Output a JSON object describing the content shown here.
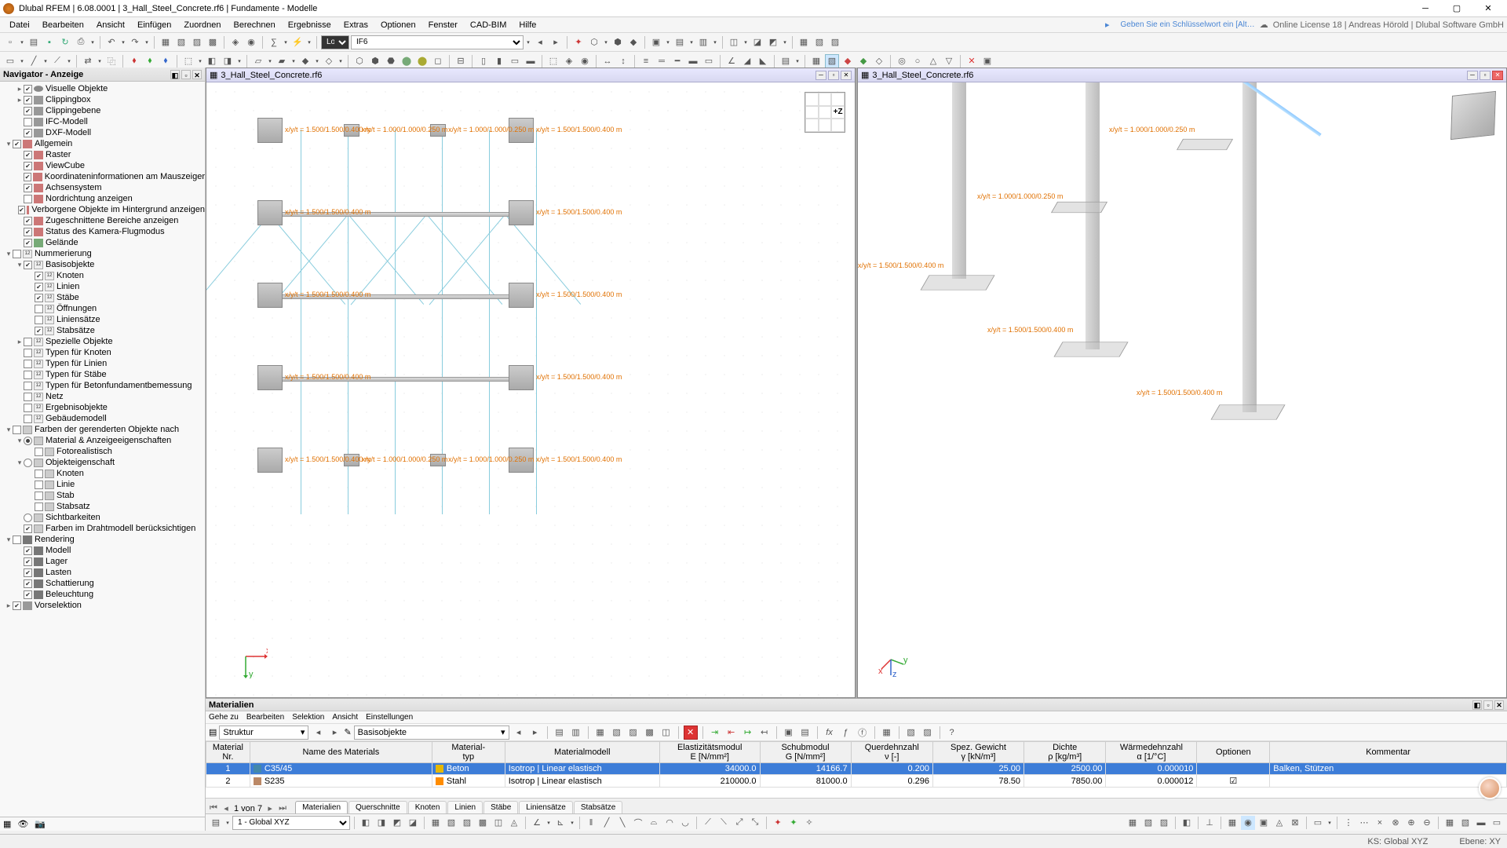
{
  "app": {
    "title": "Dlubal RFEM | 6.08.0001 | 3_Hall_Steel_Concrete.rf6 | Fundamente - Modelle"
  },
  "header": {
    "hint": "Geben Sie ein Schlüsselwort ein [Alt…",
    "license": "Online License 18 | Andreas Hörold | Dlubal Software GmbH"
  },
  "menu": {
    "items": [
      "Datei",
      "Bearbeiten",
      "Ansicht",
      "Einfügen",
      "Zuordnen",
      "Berechnen",
      "Ergebnisse",
      "Extras",
      "Optionen",
      "Fenster",
      "CAD-BIM",
      "Hilfe"
    ]
  },
  "tb1_combo_lol": "LoI",
  "tb1_combo_if": "IF6",
  "navigator": {
    "title": "Navigator - Anzeige",
    "footer_cam_icon": "📷",
    "tree": [
      {
        "d": 1,
        "tw": "▸",
        "cb": true,
        "icon": "ic-eye",
        "label": "Visuelle Objekte"
      },
      {
        "d": 1,
        "tw": "▸",
        "cb": true,
        "icon": "ic-cube",
        "label": "Clippingbox"
      },
      {
        "d": 1,
        "tw": "",
        "cb": true,
        "icon": "ic-cube",
        "label": "Clippingebene"
      },
      {
        "d": 1,
        "tw": "",
        "cb": false,
        "icon": "ic-cube",
        "label": "IFC-Modell"
      },
      {
        "d": 1,
        "tw": "",
        "cb": true,
        "icon": "ic-cube",
        "label": "DXF-Modell"
      },
      {
        "d": 0,
        "tw": "▾",
        "cb": true,
        "icon": "ic-layer",
        "label": "Allgemein"
      },
      {
        "d": 1,
        "tw": "",
        "cb": true,
        "icon": "ic-layer",
        "label": "Raster"
      },
      {
        "d": 1,
        "tw": "",
        "cb": true,
        "icon": "ic-layer",
        "label": "ViewCube"
      },
      {
        "d": 1,
        "tw": "",
        "cb": true,
        "icon": "ic-layer",
        "label": "Koordinateninformationen am Mauszeiger"
      },
      {
        "d": 1,
        "tw": "",
        "cb": true,
        "icon": "ic-layer",
        "label": "Achsensystem"
      },
      {
        "d": 1,
        "tw": "",
        "cb": false,
        "icon": "ic-layer",
        "label": "Nordrichtung anzeigen"
      },
      {
        "d": 1,
        "tw": "",
        "cb": true,
        "icon": "ic-layer",
        "label": "Verborgene Objekte im Hintergrund anzeigen"
      },
      {
        "d": 1,
        "tw": "",
        "cb": true,
        "icon": "ic-layer",
        "label": "Zugeschnittene Bereiche anzeigen"
      },
      {
        "d": 1,
        "tw": "",
        "cb": true,
        "icon": "ic-layer",
        "label": "Status des Kamera-Flugmodus"
      },
      {
        "d": 1,
        "tw": "",
        "cb": true,
        "icon": "ic-layer2",
        "label": "Gelände"
      },
      {
        "d": 0,
        "tw": "▾",
        "cb": false,
        "icon": "ic-num",
        "label": "Nummerierung"
      },
      {
        "d": 1,
        "tw": "▾",
        "cb": true,
        "icon": "ic-num",
        "label": "Basisobjekte"
      },
      {
        "d": 2,
        "tw": "",
        "cb": true,
        "icon": "ic-num",
        "label": "Knoten"
      },
      {
        "d": 2,
        "tw": "",
        "cb": true,
        "icon": "ic-num",
        "label": "Linien"
      },
      {
        "d": 2,
        "tw": "",
        "cb": true,
        "icon": "ic-num",
        "label": "Stäbe"
      },
      {
        "d": 2,
        "tw": "",
        "cb": false,
        "icon": "ic-num",
        "label": "Öffnungen"
      },
      {
        "d": 2,
        "tw": "",
        "cb": false,
        "icon": "ic-num",
        "label": "Liniensätze"
      },
      {
        "d": 2,
        "tw": "",
        "cb": true,
        "icon": "ic-num",
        "label": "Stabsätze"
      },
      {
        "d": 1,
        "tw": "▸",
        "cb": false,
        "icon": "ic-num",
        "label": "Spezielle Objekte"
      },
      {
        "d": 1,
        "tw": "",
        "cb": false,
        "icon": "ic-num",
        "label": "Typen für Knoten"
      },
      {
        "d": 1,
        "tw": "",
        "cb": false,
        "icon": "ic-num",
        "label": "Typen für Linien"
      },
      {
        "d": 1,
        "tw": "",
        "cb": false,
        "icon": "ic-num",
        "label": "Typen für Stäbe"
      },
      {
        "d": 1,
        "tw": "",
        "cb": false,
        "icon": "ic-num",
        "label": "Typen für Betonfundamentbemessung"
      },
      {
        "d": 1,
        "tw": "",
        "cb": false,
        "icon": "ic-num",
        "label": "Netz"
      },
      {
        "d": 1,
        "tw": "",
        "cb": false,
        "icon": "ic-num",
        "label": "Ergebnisobjekte"
      },
      {
        "d": 1,
        "tw": "",
        "cb": false,
        "icon": "ic-num",
        "label": "Gebäudemodell"
      },
      {
        "d": 0,
        "tw": "▾",
        "cb": null,
        "icon": "ic-col",
        "label": "Farben der gerenderten Objekte nach"
      },
      {
        "d": 1,
        "tw": "▾",
        "rb": true,
        "icon": "ic-col",
        "label": "Material & Anzeigeeigenschaften"
      },
      {
        "d": 2,
        "tw": "",
        "cb": false,
        "icon": "ic-col",
        "label": "Fotorealistisch"
      },
      {
        "d": 1,
        "tw": "▾",
        "rb": false,
        "icon": "ic-col",
        "label": "Objekteigenschaft"
      },
      {
        "d": 2,
        "tw": "",
        "cb": false,
        "icon": "ic-col",
        "label": "Knoten"
      },
      {
        "d": 2,
        "tw": "",
        "cb": false,
        "icon": "ic-col",
        "label": "Linie"
      },
      {
        "d": 2,
        "tw": "",
        "cb": false,
        "icon": "ic-col",
        "label": "Stab"
      },
      {
        "d": 2,
        "tw": "",
        "cb": false,
        "icon": "ic-col",
        "label": "Stabsatz"
      },
      {
        "d": 1,
        "tw": "",
        "rb": false,
        "icon": "ic-col",
        "label": "Sichtbarkeiten"
      },
      {
        "d": 1,
        "tw": "",
        "cb": true,
        "icon": "ic-col",
        "label": "Farben im Drahtmodell berücksichtigen"
      },
      {
        "d": 0,
        "tw": "▾",
        "cb": null,
        "icon": "ic-rend",
        "label": "Rendering"
      },
      {
        "d": 1,
        "tw": "",
        "cb": true,
        "icon": "ic-rend",
        "label": "Modell"
      },
      {
        "d": 1,
        "tw": "",
        "cb": true,
        "icon": "ic-rend",
        "label": "Lager"
      },
      {
        "d": 1,
        "tw": "",
        "cb": true,
        "icon": "ic-rend",
        "label": "Lasten"
      },
      {
        "d": 1,
        "tw": "",
        "cb": true,
        "icon": "ic-rend",
        "label": "Schattierung"
      },
      {
        "d": 1,
        "tw": "",
        "cb": true,
        "icon": "ic-rend",
        "label": "Beleuchtung"
      },
      {
        "d": 0,
        "tw": "▸",
        "cb": true,
        "icon": "ic-cube",
        "label": "Vorselektion"
      }
    ]
  },
  "views": {
    "left": {
      "title": "3_Hall_Steel_Concrete.rf6",
      "cube_label": "+Z"
    },
    "right": {
      "title": "3_Hall_Steel_Concrete.rf6"
    }
  },
  "anno": {
    "l1": "x/y/t = 1.500/1.500/0.400 m",
    "l2": "x/y/t = 1.000/1.000/0.250 m",
    "l3": "x/y/t = 1.000/1.000/0.250 m",
    "r1": "x/y/t = 1.500/1.500/0.400 m",
    "r2": "x/y/t = 1.000/1.000/0.250 m"
  },
  "materials": {
    "title": "Materialien",
    "menu": [
      "Gehe zu",
      "Bearbeiten",
      "Selektion",
      "Ansicht",
      "Einstellungen"
    ],
    "combo_left": "Struktur",
    "combo_right": "Basisobjekte",
    "cols": [
      "Material\nNr.",
      "Name des Materials",
      "Material-\ntyp",
      "Materialmodell",
      "Elastizitätsmodul\nE [N/mm²]",
      "Schubmodul\nG [N/mm²]",
      "Querdehnzahl\nν [-]",
      "Spez. Gewicht\nγ [kN/m³]",
      "Dichte\nρ [kg/m³]",
      "Wärmedehnzahl\nα [1/°C]",
      "Optionen",
      "Kommentar"
    ],
    "rows": [
      {
        "nr": "1",
        "name": "C35/45",
        "sw": "#48a",
        "typ": "Beton",
        "typ_sw": "#e6b800",
        "model": "Isotrop | Linear elastisch",
        "E": "34000.0",
        "G": "14166.7",
        "v": "0.200",
        "g": "25.00",
        "rho": "2500.00",
        "a": "0.000010",
        "opt": "",
        "kom": "Balken, Stützen",
        "sel": true
      },
      {
        "nr": "2",
        "name": "S235",
        "sw": "#b86",
        "typ": "Stahl",
        "typ_sw": "#ff8c00",
        "model": "Isotrop | Linear elastisch",
        "E": "210000.0",
        "G": "81000.0",
        "v": "0.296",
        "g": "78.50",
        "rho": "7850.00",
        "a": "0.000012",
        "opt": "☑",
        "kom": "",
        "sel": false
      }
    ],
    "pager": {
      "label": "1 von 7"
    },
    "tabs": [
      "Materialien",
      "Querschnitte",
      "Knoten",
      "Linien",
      "Stäbe",
      "Liniensätze",
      "Stabsätze"
    ],
    "active_tab": 0
  },
  "bottom_combo": "1 - Global XYZ",
  "status": {
    "ks": "KS: Global XYZ",
    "ebene": "Ebene: XY"
  }
}
